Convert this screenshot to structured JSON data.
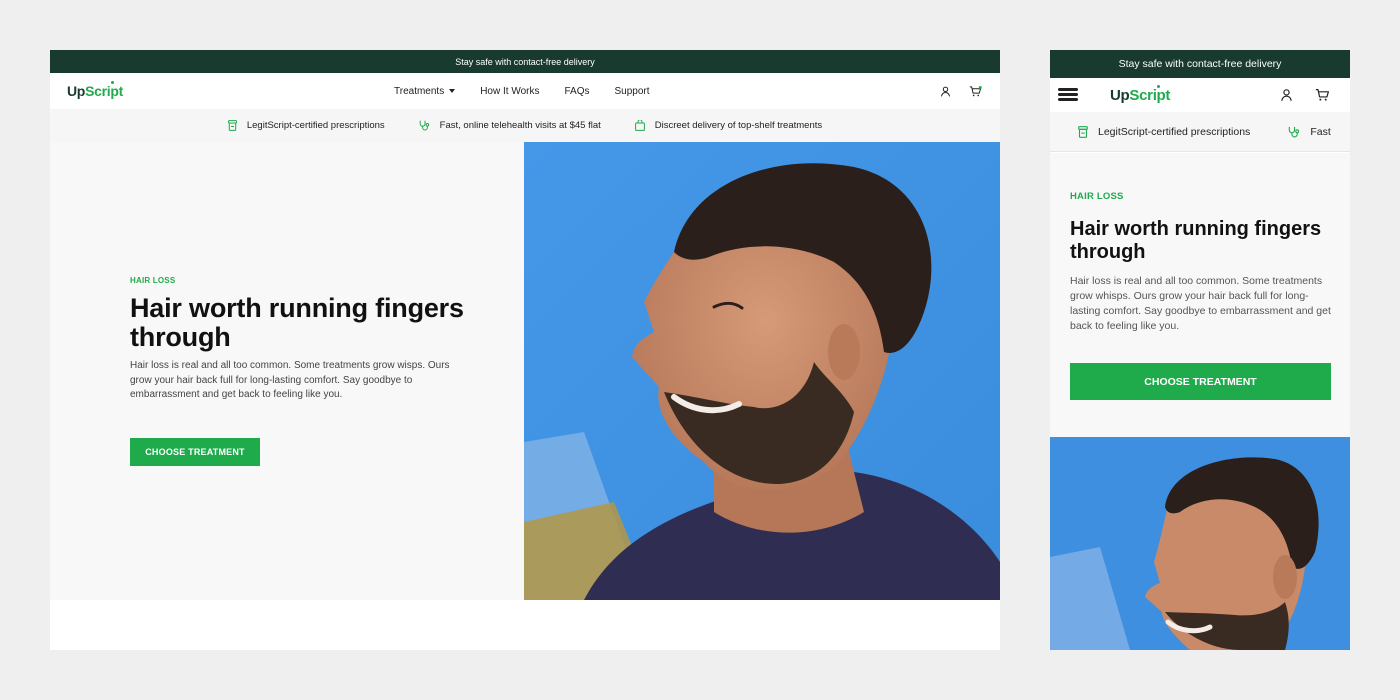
{
  "brand": {
    "name_part1": "Up",
    "name_part2": "Script",
    "colors": {
      "primary_dark": "#183a2f",
      "accent_green": "#1fab4c",
      "hero_blue": "#3f8fe0"
    }
  },
  "desktop": {
    "announcement": "Stay safe with contact-free delivery",
    "nav": {
      "items": [
        {
          "label": "Treatments",
          "has_dropdown": true
        },
        {
          "label": "How It Works",
          "has_dropdown": false
        },
        {
          "label": "FAQs",
          "has_dropdown": false
        },
        {
          "label": "Support",
          "has_dropdown": false
        }
      ],
      "icons": [
        "user-icon",
        "cart-icon"
      ]
    },
    "trust_items": [
      {
        "icon": "prescription-bottle-icon",
        "label": "LegitScript-certified prescriptions"
      },
      {
        "icon": "stethoscope-icon",
        "label": "Fast, online telehealth visits at $45 flat"
      },
      {
        "icon": "package-icon",
        "label": "Discreet delivery of top-shelf treatments"
      }
    ],
    "hero": {
      "eyebrow": "HAIR LOSS",
      "title": "Hair worth running fingers through",
      "body": "Hair loss is real and all too common. Some treatments grow wisps. Ours grow your hair back full for long-lasting comfort. Say goodbye to embarrassment and get back to feeling like you.",
      "cta": "CHOOSE TREATMENT"
    }
  },
  "mobile": {
    "announcement": "Stay safe with contact-free delivery",
    "icons": [
      "menu-icon",
      "user-icon",
      "cart-icon"
    ],
    "trust_items": [
      {
        "icon": "prescription-bottle-icon",
        "label": "LegitScript-certified prescriptions"
      },
      {
        "icon": "stethoscope-icon",
        "label": "Fast"
      }
    ],
    "hero": {
      "eyebrow": "HAIR LOSS",
      "title": "Hair worth running fingers through",
      "body": "Hair loss is real and all too common. Some treatments grow whisps. Ours grow your hair back full for long-lasting comfort. Say goodbye to embarrassment and get back to feeling like you.",
      "cta": "CHOOSE TREATMENT"
    }
  }
}
